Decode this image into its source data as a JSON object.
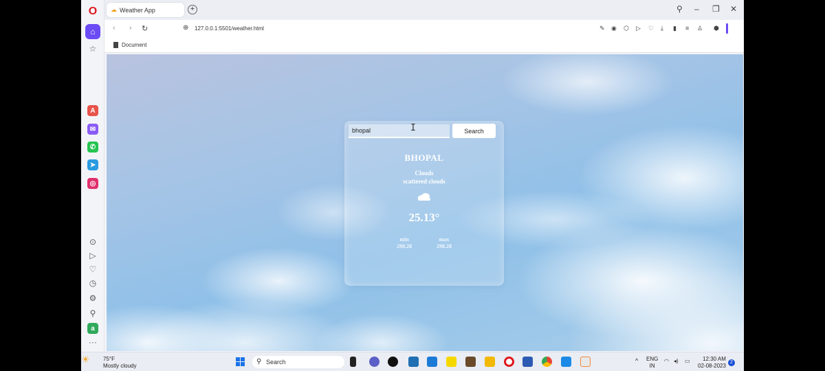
{
  "browser": {
    "tab_title": "Weather App",
    "url": "127.0.0.1:5501/weather.html",
    "bookmark": "Document"
  },
  "weather": {
    "search_value": "bhopal",
    "search_button": "Search",
    "city": "BHOPAL",
    "condition": "Clouds",
    "description": "scattered clouds",
    "temperature": "25.13°",
    "min_label": "min",
    "min_value": "298.28",
    "max_label": "max",
    "max_value": "298.28"
  },
  "taskbar": {
    "weather_temp": "75°F",
    "weather_desc": "Mostly cloudy",
    "search_label": "Search",
    "lang_top": "ENG",
    "lang_bottom": "IN",
    "time": "12:30 AM",
    "date": "02-08-2023",
    "notif_count": "2"
  }
}
